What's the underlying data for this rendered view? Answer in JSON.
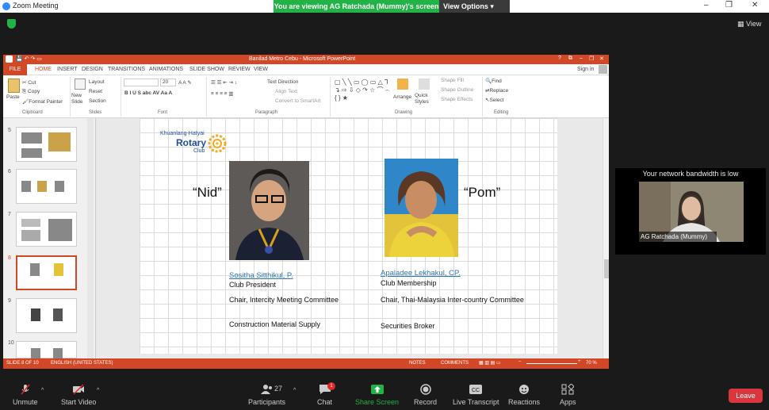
{
  "zoom": {
    "window_title": "Zoom Meeting",
    "banner_text": "You are viewing AG Ratchada (Mummy)'s screen",
    "view_options": "View Options",
    "view_label": "View",
    "window_controls": [
      "–",
      "❐",
      "✕"
    ]
  },
  "ppt": {
    "title": "Banilad Metro Cebu  -  Microsoft PowerPoint",
    "title_controls": [
      "?",
      "⧉",
      "–",
      "❐",
      "✕"
    ],
    "file_tab": "FILE",
    "tabs": [
      "HOME",
      "INSERT",
      "DESIGN",
      "TRANSITIONS",
      "ANIMATIONS",
      "SLIDE SHOW",
      "REVIEW",
      "VIEW"
    ],
    "sign_in": "Sign in",
    "ribbon": {
      "paste": "Paste",
      "cut": "Cut",
      "copy": "Copy",
      "format_painter": "Format Painter",
      "new_slide": "New Slide",
      "layout": "Layout",
      "reset": "Reset",
      "section": "Section",
      "font_size": "20",
      "text_direction": "Text Direction",
      "align_text": "Align Text",
      "convert_smartart": "Convert to SmartArt",
      "arrange": "Arrange",
      "quick_styles": "Quick Styles",
      "shape_fill": "Shape Fill",
      "shape_outline": "Shape Outline",
      "shape_effects": "Shape Effects",
      "find": "Find",
      "replace": "Replace",
      "select": "Select",
      "groups": [
        "Clipboard",
        "Slides",
        "Font",
        "Paragraph",
        "Drawing",
        "Editing"
      ]
    },
    "thumb_numbers": [
      "5",
      "6",
      "7",
      "8",
      "9",
      "10"
    ],
    "status": {
      "slide": "SLIDE 8 OF 10",
      "language": "ENGLISH (UNITED STATES)",
      "notes": "NOTES",
      "comments": "COMMENTS",
      "zoom": "70 %"
    }
  },
  "slide": {
    "logo_top": "Khuanlang-Hatyai",
    "logo_main": "Rotary",
    "logo_sub": "Club",
    "left": {
      "nick": "“Nid”",
      "name": "Sositha Sitthikul, P.",
      "role1": "Club President",
      "role2": "Chair, Intercity Meeting Committee",
      "role3": "Construction Material Supply"
    },
    "right": {
      "nick": "“Pom”",
      "name": "Apaladee Lekhakul, CP.",
      "role1": "Club Membership",
      "role2": "Chair, Thai-Malaysia Inter-country Committee",
      "role3": "Securities Broker"
    }
  },
  "participant": {
    "bandwidth": "Your network bandwidth is low",
    "name": "AG Ratchada (Mummy)"
  },
  "toolbar": {
    "unmute": "Unmute",
    "start_video": "Start Video",
    "participants": "Participants",
    "participants_count": "27",
    "chat": "Chat",
    "chat_badge": "1",
    "share_screen": "Share Screen",
    "record": "Record",
    "live_transcript": "Live Transcript",
    "reactions": "Reactions",
    "apps": "Apps",
    "leave": "Leave"
  },
  "colors": {
    "zoom_green": "#23b245",
    "ppt_orange": "#d24726",
    "leave_red": "#d9363e",
    "name_blue": "#2e75b6"
  }
}
